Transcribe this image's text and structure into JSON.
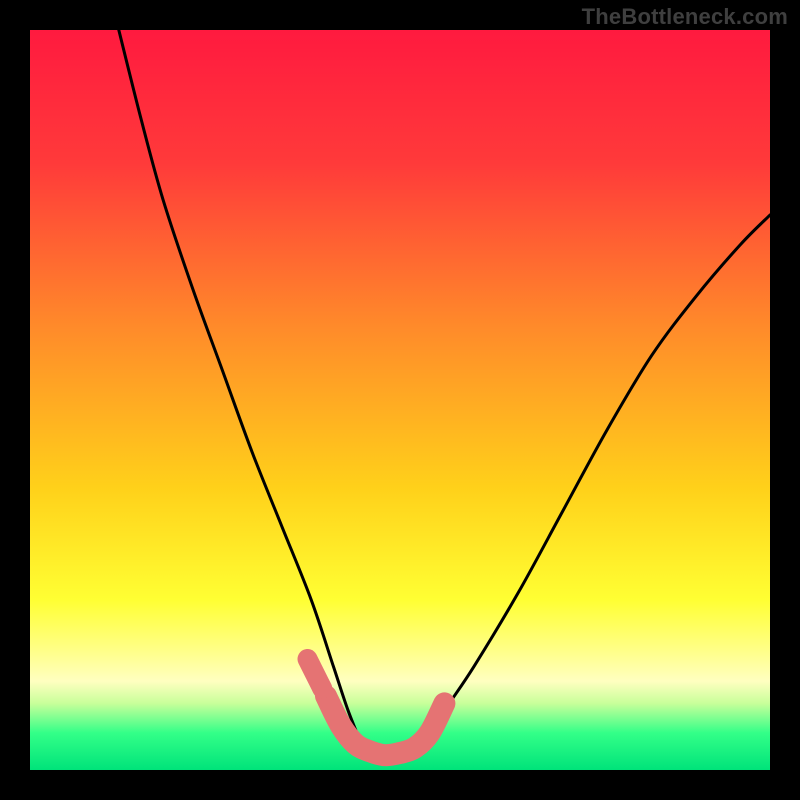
{
  "watermark": "TheBottleneck.com",
  "chart_data": {
    "type": "line",
    "title": "",
    "xlabel": "",
    "ylabel": "",
    "xlim": [
      0,
      100
    ],
    "ylim": [
      0,
      100
    ],
    "grid": false,
    "legend": false,
    "gradient_stops": [
      {
        "offset": 0,
        "color": "#ff1a3f"
      },
      {
        "offset": 18,
        "color": "#ff3a3a"
      },
      {
        "offset": 40,
        "color": "#ff8a2a"
      },
      {
        "offset": 62,
        "color": "#ffd11a"
      },
      {
        "offset": 77,
        "color": "#ffff33"
      },
      {
        "offset": 84,
        "color": "#ffff8a"
      },
      {
        "offset": 88,
        "color": "#ffffc0"
      },
      {
        "offset": 91,
        "color": "#c8ff9a"
      },
      {
        "offset": 95,
        "color": "#33ff88"
      },
      {
        "offset": 100,
        "color": "#00e37a"
      }
    ],
    "series": [
      {
        "name": "left-curve",
        "comment": "Steep convex descent from top-left to the valley floor around x≈45",
        "x": [
          12,
          15,
          18,
          22,
          26,
          30,
          34,
          38,
          41,
          43,
          45
        ],
        "y": [
          100,
          88,
          77,
          65,
          54,
          43,
          33,
          23,
          14,
          8,
          3
        ]
      },
      {
        "name": "right-curve",
        "comment": "Gentler convex rise from valley around x≈53 to upper-right",
        "x": [
          53,
          56,
          60,
          66,
          72,
          78,
          84,
          90,
          96,
          100
        ],
        "y": [
          3,
          8,
          14,
          24,
          35,
          46,
          56,
          64,
          71,
          75
        ]
      },
      {
        "name": "valley-highlight",
        "comment": "Thick coral U mark at the valley bottom",
        "x": [
          40,
          42,
          44,
          46,
          48,
          50,
          52,
          54,
          56
        ],
        "y": [
          10,
          6,
          3.5,
          2.5,
          2,
          2.3,
          3,
          5,
          9
        ]
      }
    ]
  }
}
